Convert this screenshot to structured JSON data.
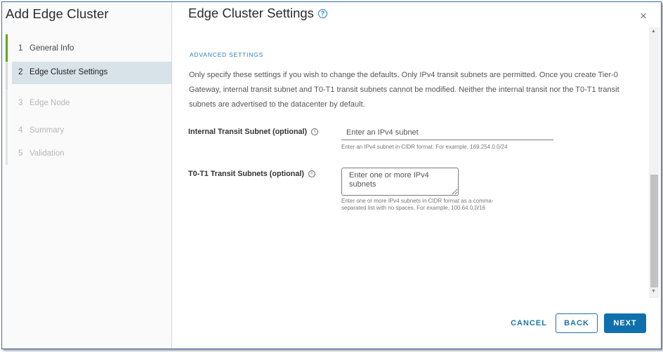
{
  "dialog": {
    "title": "Add Edge Cluster"
  },
  "steps": [
    {
      "num": "1",
      "label": "General Info",
      "state": "done"
    },
    {
      "num": "2",
      "label": "Edge Cluster Settings",
      "state": "active"
    },
    {
      "num": "3",
      "label": "Edge Node",
      "state": "disabled"
    },
    {
      "num": "4",
      "label": "Summary",
      "state": "disabled"
    },
    {
      "num": "5",
      "label": "Validation",
      "state": "disabled"
    }
  ],
  "main": {
    "title": "Edge Cluster Settings",
    "help_glyph": "?",
    "close_glyph": "×",
    "section_heading": "ADVANCED SETTINGS",
    "description": "Only specify these settings if you wish to change the defaults. Only IPv4 transit subnets are permitted. Once you create Tier-0 Gateway, internal transit subnet and T0-T1 transit subnets cannot be modified. Neither the internal transit nor the T0-T1 transit subnets are advertised to the datacenter by default.",
    "internal_transit": {
      "label": "Internal Transit Subnet (optional)",
      "info_glyph": "i",
      "placeholder": "Enter an IPv4 subnet",
      "value": "",
      "hint": "Enter an IPv4 subnet in CIDR format. For example, 169.254.0.0/24"
    },
    "t0_t1_transit": {
      "label": "T0-T1 Transit Subnets (optional)",
      "info_glyph": "i",
      "placeholder": "Enter one or more IPv4 subnets",
      "value": "",
      "hint_line1": "Enter one or more IPv4 subnets in CIDR format as a comma-",
      "hint_line2": "separated list with no spaces. For example, 100.64.0.0/16"
    }
  },
  "scrollbar": {
    "up_glyph": "▲",
    "down_glyph": "▼"
  },
  "footer": {
    "cancel_label": "CANCEL",
    "back_label": "BACK",
    "next_label": "NEXT"
  },
  "colors": {
    "accent": "#0f70ad",
    "step_done": "#62a420",
    "active_step_bg": "#d8e3e9",
    "section_heading": "#2d7fb4"
  }
}
